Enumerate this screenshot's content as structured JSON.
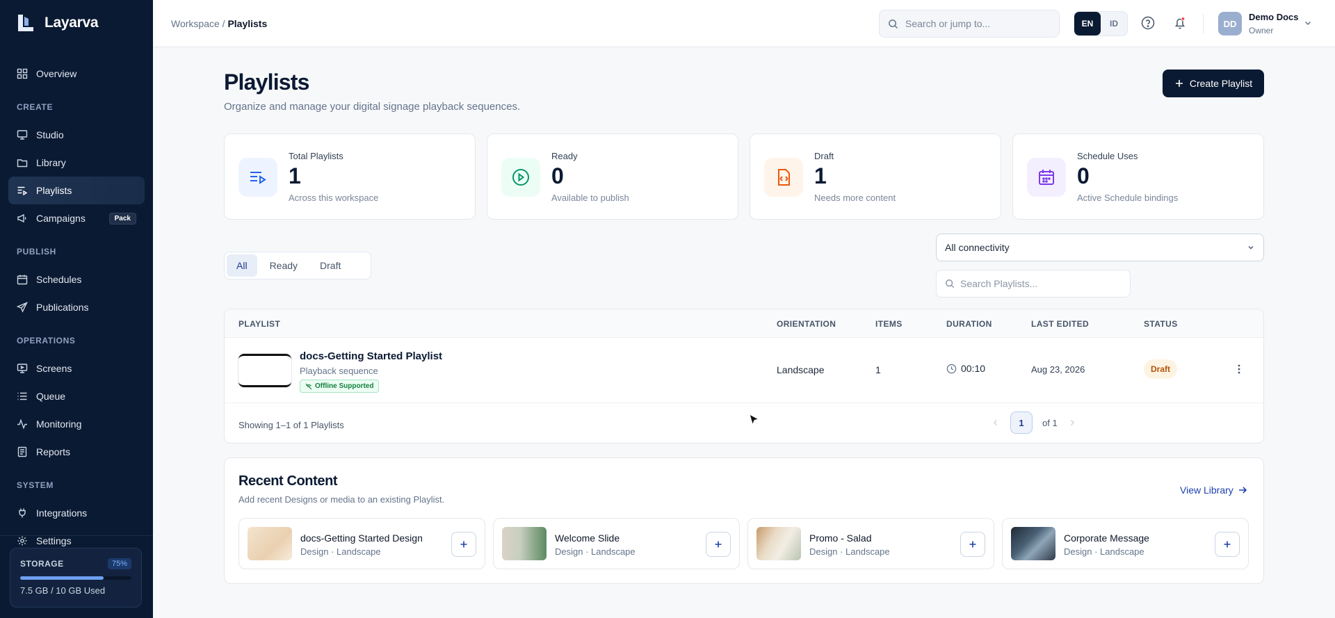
{
  "app": {
    "name": "Layarva"
  },
  "sidebar": {
    "overview": "Overview",
    "sections": {
      "create": "CREATE",
      "publish": "PUBLISH",
      "operations": "OPERATIONS",
      "system": "SYSTEM"
    },
    "create_items": [
      {
        "label": "Studio",
        "icon": "monitor-icon"
      },
      {
        "label": "Library",
        "icon": "folder-icon"
      },
      {
        "label": "Playlists",
        "icon": "playlist-icon",
        "active": true
      },
      {
        "label": "Campaigns",
        "icon": "megaphone-icon",
        "badge": "Pack"
      }
    ],
    "publish_items": [
      {
        "label": "Schedules",
        "icon": "calendar-icon"
      },
      {
        "label": "Publications",
        "icon": "send-icon"
      }
    ],
    "operations_items": [
      {
        "label": "Screens",
        "icon": "screen-icon"
      },
      {
        "label": "Queue",
        "icon": "list-icon"
      },
      {
        "label": "Monitoring",
        "icon": "activity-icon"
      },
      {
        "label": "Reports",
        "icon": "report-icon"
      }
    ],
    "system_items": [
      {
        "label": "Integrations",
        "icon": "plug-icon"
      },
      {
        "label": "Settings",
        "icon": "gear-icon"
      }
    ],
    "storage": {
      "title": "STORAGE",
      "percent_label": "75%",
      "fill_fraction": 0.75,
      "used": "7.5 GB / 10 GB Used"
    }
  },
  "topbar": {
    "breadcrumb_root": "Workspace /",
    "breadcrumb_current": "Playlists",
    "search_placeholder": "Search or jump to...",
    "lang_en": "EN",
    "lang_id": "ID",
    "user": {
      "initials": "DD",
      "name": "Demo Docs",
      "role": "Owner"
    }
  },
  "page": {
    "title": "Playlists",
    "subtitle": "Organize and manage your digital signage playback sequences.",
    "create_button": "Create Playlist"
  },
  "stats": [
    {
      "label": "Total Playlists",
      "value": "1",
      "note": "Across this workspace",
      "color": "#2563eb"
    },
    {
      "label": "Ready",
      "value": "0",
      "note": "Available to publish",
      "color": "#059669"
    },
    {
      "label": "Draft",
      "value": "1",
      "note": "Needs more content",
      "color": "#ea580c"
    },
    {
      "label": "Schedule Uses",
      "value": "0",
      "note": "Active Schedule bindings",
      "color": "#7c3aed"
    }
  ],
  "filters": {
    "tabs": [
      "All",
      "Ready",
      "Draft"
    ],
    "connectivity": "All connectivity",
    "search_placeholder": "Search Playlists..."
  },
  "table": {
    "headers": [
      "PLAYLIST",
      "ORIENTATION",
      "ITEMS",
      "DURATION",
      "LAST EDITED",
      "STATUS"
    ],
    "rows": [
      {
        "name": "docs-Getting Started Playlist",
        "subtitle": "Playback sequence",
        "badge": "Offline Supported",
        "orientation": "Landscape",
        "items": "1",
        "duration": "00:10",
        "last_edited": "Aug 23, 2026",
        "status": "Draft"
      }
    ],
    "footer": "Showing 1–1 of 1 Playlists",
    "page": "1",
    "of": "of 1"
  },
  "recent": {
    "title": "Recent Content",
    "subtitle": "Add recent Designs or media to an existing Playlist.",
    "link": "View Library",
    "items": [
      {
        "name": "docs-Getting Started Design",
        "meta": "Design · Landscape"
      },
      {
        "name": "Welcome Slide",
        "meta": "Design · Landscape"
      },
      {
        "name": "Promo - Salad",
        "meta": "Design · Landscape"
      },
      {
        "name": "Corporate Message",
        "meta": "Design · Landscape"
      }
    ]
  }
}
